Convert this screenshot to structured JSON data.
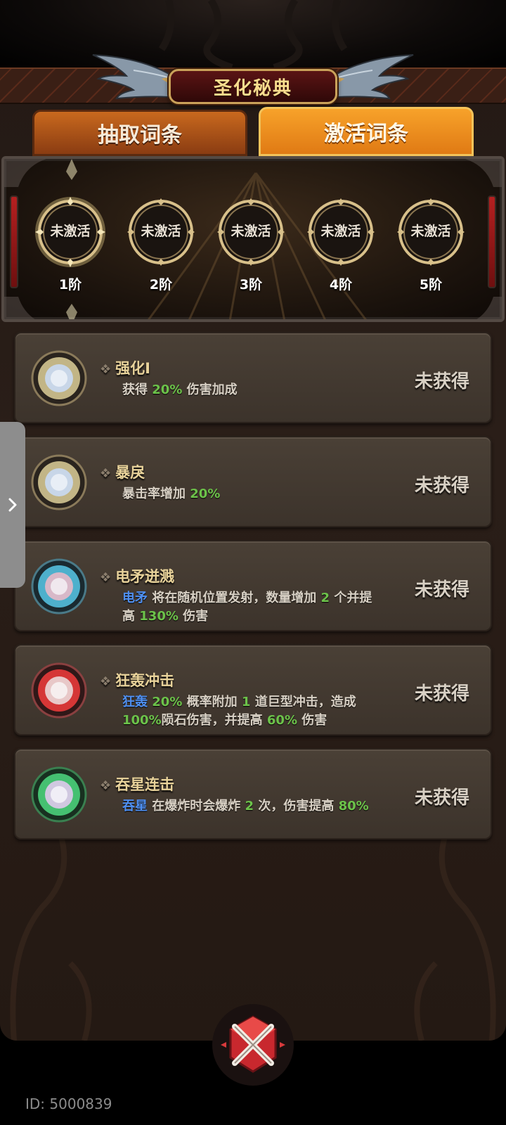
{
  "header": {
    "title": "圣化秘典"
  },
  "tabs": [
    {
      "label": "抽取词条",
      "active": false
    },
    {
      "label": "激活词条",
      "active": true
    }
  ],
  "stages": [
    {
      "status": "未激活",
      "label": "1阶",
      "highlighted": true
    },
    {
      "status": "未激活",
      "label": "2阶",
      "highlighted": false
    },
    {
      "status": "未激活",
      "label": "3阶",
      "highlighted": false
    },
    {
      "status": "未激活",
      "label": "4阶",
      "highlighted": false
    },
    {
      "status": "未激活",
      "label": "5阶",
      "highlighted": false
    }
  ],
  "cards": [
    {
      "title": "强化I",
      "orb_color": "#e8d9a0",
      "desc_parts": [
        {
          "t": "获得 "
        },
        {
          "t": "20%",
          "c": "green"
        },
        {
          "t": " 伤害加成"
        }
      ],
      "status": "未获得"
    },
    {
      "title": "暴戾",
      "orb_color": "#e8d9a0",
      "desc_parts": [
        {
          "t": "暴击率增加 "
        },
        {
          "t": "20%",
          "c": "green"
        }
      ],
      "status": "未获得"
    },
    {
      "title": "电矛迸溅",
      "orb_color": "#58c8e8",
      "desc_parts": [
        {
          "t": "电矛",
          "c": "blue"
        },
        {
          "t": " 将在随机位置发射，数量增加 "
        },
        {
          "t": "2",
          "c": "green"
        },
        {
          "t": " 个并提高 "
        },
        {
          "t": "130%",
          "c": "green"
        },
        {
          "t": " 伤害"
        }
      ],
      "status": "未获得"
    },
    {
      "title": "狂轰冲击",
      "orb_color": "#e83a3a",
      "desc_parts": [
        {
          "t": "狂轰",
          "c": "blue"
        },
        {
          "t": " "
        },
        {
          "t": "20%",
          "c": "green"
        },
        {
          "t": " 概率附加 "
        },
        {
          "t": "1",
          "c": "green"
        },
        {
          "t": " 道巨型冲击，造成 "
        },
        {
          "t": "100%",
          "c": "green"
        },
        {
          "t": "陨石伤害，并提高 "
        },
        {
          "t": "60%",
          "c": "green"
        },
        {
          "t": " 伤害"
        }
      ],
      "status": "未获得"
    },
    {
      "title": "吞星连击",
      "orb_color": "#4ad07a",
      "desc_parts": [
        {
          "t": "吞星",
          "c": "blue"
        },
        {
          "t": " 在爆炸时会爆炸 "
        },
        {
          "t": "2",
          "c": "green"
        },
        {
          "t": " 次，伤害提高 "
        },
        {
          "t": "80%",
          "c": "green"
        }
      ],
      "status": "未获得"
    }
  ],
  "footer": {
    "id_text": "ID: 5000839"
  },
  "icons": {
    "side_handle": "chevron-right-icon",
    "close": "close-crossed-swords-icon"
  },
  "colors": {
    "accent_orange": "#f7a22a",
    "title_gold": "#f8dd8e",
    "value_green": "#6cc24a",
    "skill_blue": "#4f8ff0"
  }
}
